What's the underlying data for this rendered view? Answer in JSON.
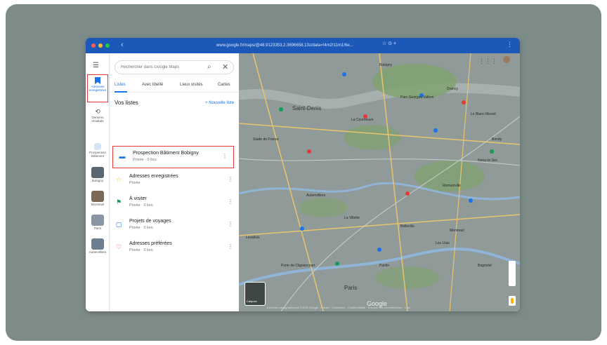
{
  "colors": {
    "frame": "#7e8c89",
    "chrome": "#1c58b8",
    "accent": "#1a73e8",
    "highlight": "#e53935",
    "map_base": "#8f9a99",
    "park": "#7ea36e",
    "water": "#8fb4d6",
    "road": "#e9c46a",
    "traffic_light": [
      "#ff5f57",
      "#febc2e",
      "#28c840"
    ]
  },
  "browser": {
    "url": "www.google.fr/maps/@48.9123353,2.3696658,13z/data=!4m2!11m1!6e...",
    "url_icons": "☆ ⊙ +",
    "menu_icon": "⋮"
  },
  "rail": {
    "menu_icon": "☰",
    "saved_label": "Adresses enregistrées",
    "recents_label": "Derniers résultats",
    "items": [
      {
        "label": "Prospection Bâtiment"
      },
      {
        "label": "Bobigny"
      },
      {
        "label": "Montreuil"
      },
      {
        "label": "Paris"
      },
      {
        "label": "Aubervilliers"
      }
    ]
  },
  "search": {
    "placeholder": "Rechercher dans Google Maps",
    "search_icon": "⌕",
    "close_icon": "✕"
  },
  "tabs": [
    {
      "label": "Listes",
      "active": true
    },
    {
      "label": "Avec libellé",
      "active": false
    },
    {
      "label": "Lieux visités",
      "active": false
    },
    {
      "label": "Cartes",
      "active": false
    }
  ],
  "lists": {
    "title": "Vos listes",
    "new_list": "+ Nouvelle liste",
    "more_icon": "⋮",
    "items": [
      {
        "name": "Prospection Bâtiment Bobigny",
        "sub": "Privée · 0 lieu",
        "icon": "flag-icon",
        "glyph": "▬",
        "color": "#1a73e8",
        "highlight": true
      },
      {
        "name": "Adresses enregistrées",
        "sub": "Privée",
        "icon": "star-icon",
        "glyph": "☆",
        "color": "#f4b400",
        "highlight": false
      },
      {
        "name": "À visiter",
        "sub": "Privée · 0 lieu",
        "icon": "flag-icon",
        "glyph": "⚑",
        "color": "#0f9d58",
        "highlight": false
      },
      {
        "name": "Projets de voyages",
        "sub": "Privée · 0 lieu",
        "icon": "suitcase-icon",
        "glyph": "▢",
        "color": "#1a73e8",
        "highlight": false
      },
      {
        "name": "Adresses préférées",
        "sub": "Privée · 0 lieu",
        "icon": "heart-icon",
        "glyph": "♡",
        "color": "#e91e63",
        "highlight": false
      }
    ]
  },
  "map": {
    "labels": [
      "Saint-Denis",
      "La Courneuve",
      "Drancy",
      "Bobigny",
      "Pantin",
      "Le Blanc-Mesnil",
      "Aubervilliers",
      "Montreuil",
      "Paris",
      "Stade de France",
      "Parc Georges Valbon",
      "Porte de Clignancourt",
      "Les Lilas",
      "Bagnolet",
      "Romainville",
      "Noisy-le-Sec",
      "Bondy",
      "La Villette",
      "Belleville",
      "Levallois"
    ],
    "layers_label": "Calques",
    "google": "Google",
    "footer": "Données cartographiques ©2024 Google · France · Conditions · Confidentialité · Envoyer des commentaires · 1 km",
    "apps_icon": "⋮⋮⋮"
  }
}
